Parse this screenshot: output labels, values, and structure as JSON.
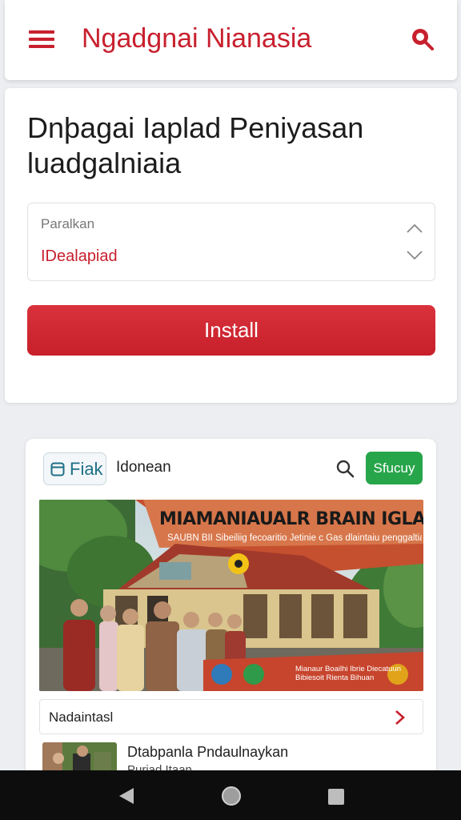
{
  "header": {
    "title": "Ngadgnai Nianasia",
    "menu_icon": "hamburger-menu-icon",
    "search_icon": "search-icon"
  },
  "main": {
    "heading": "Dnþagai Iaplad Peniyasan luadgalniaia",
    "select": {
      "label": "Paralkan",
      "value": "IDealapiad"
    },
    "install_label": "Install"
  },
  "card": {
    "chip_label": "Fiak",
    "site_name": "Idonean",
    "green_button_label": "Sfucuy",
    "banner": {
      "title": "MIAMANIAUALR BRAIN IGLARAMBAI",
      "subtitle": "SAUBN BII Sibeiliig fecoaritio Jetinie c Gas dlaintaiu penggaltian",
      "footer_text": "Mianaur Boailhi Ibrie Diecatuun Bibiesoit Rienta Bihuan"
    },
    "row_label": "Nadaintasl",
    "list_item": {
      "title": "Dtabpanla Pndaulnaykan",
      "subtitle": "Puriad Itaan"
    }
  },
  "colors": {
    "brand_red": "#c8202e",
    "green": "#27a54a",
    "chip_text": "#1f6f86"
  }
}
